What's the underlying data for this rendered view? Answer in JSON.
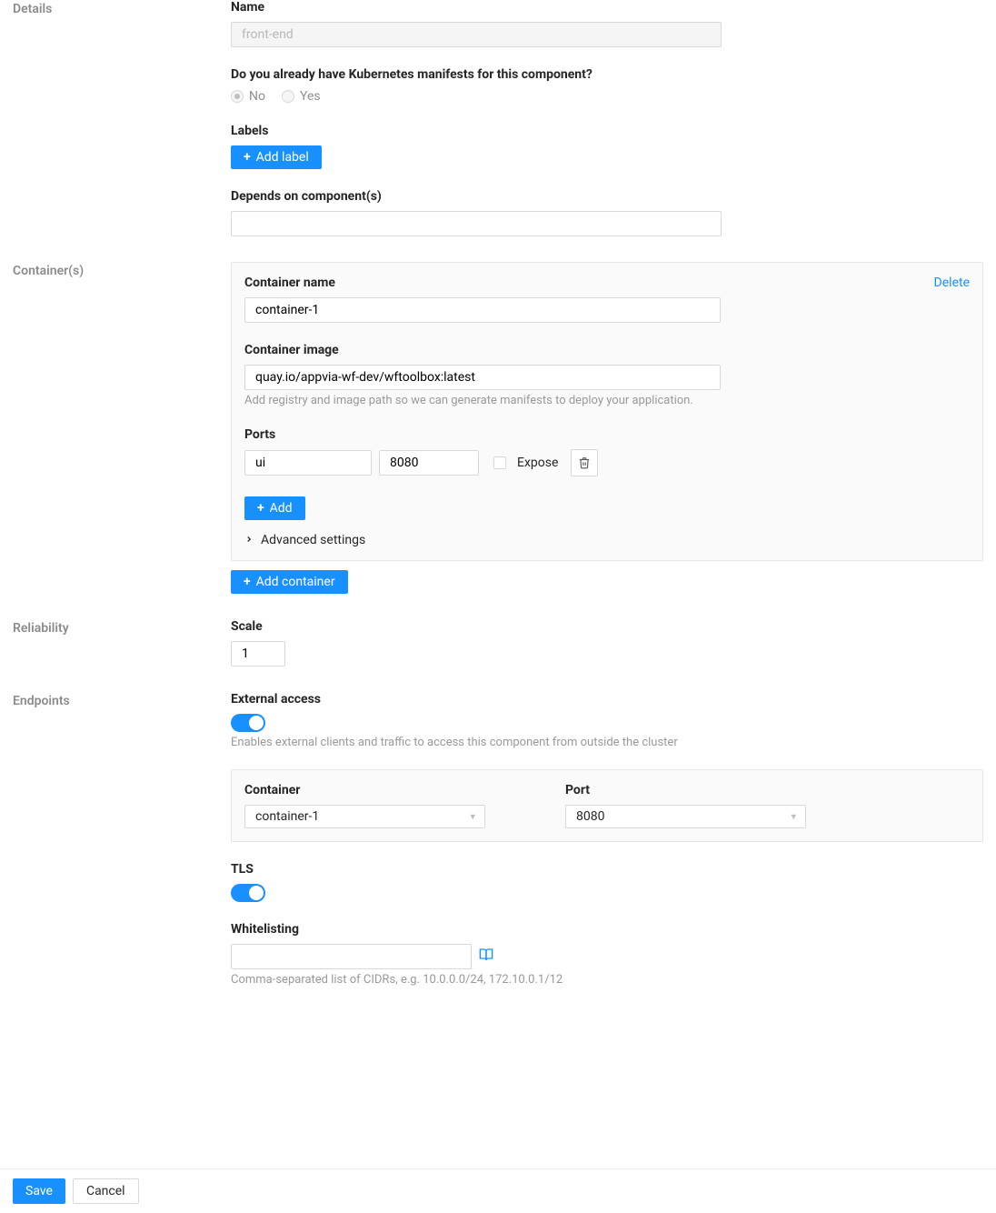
{
  "sections": {
    "details": "Details",
    "containers": "Container(s)",
    "reliability": "Reliability",
    "endpoints": "Endpoints"
  },
  "details": {
    "name_label": "Name",
    "name_value": "front-end",
    "manifests_question": "Do you already have Kubernetes manifests for this component?",
    "radio_no": "No",
    "radio_yes": "Yes",
    "labels_heading": "Labels",
    "add_label_btn": "Add label",
    "depends_label": "Depends on component(s)"
  },
  "container": {
    "delete": "Delete",
    "name_label": "Container name",
    "name_value": "container-1",
    "image_label": "Container image",
    "image_value": "quay.io/appvia-wf-dev/wftoolbox:latest",
    "image_hint": "Add registry and image path so we can generate manifests to deploy your application.",
    "ports_label": "Ports",
    "port_name": "ui",
    "port_number": "8080",
    "expose_label": "Expose",
    "add_btn": "Add",
    "advanced": "Advanced settings",
    "add_container_btn": "Add container"
  },
  "reliability": {
    "scale_label": "Scale",
    "scale_value": "1"
  },
  "endpoints": {
    "external_label": "External access",
    "external_hint": "Enables external clients and traffic to access this component from outside the cluster",
    "container_label": "Container",
    "container_value": "container-1",
    "port_label": "Port",
    "port_value": "8080",
    "tls_label": "TLS",
    "whitelist_label": "Whitelisting",
    "whitelist_hint": "Comma-separated list of CIDRs, e.g. 10.0.0.0/24, 172.10.0.1/12"
  },
  "footer": {
    "save": "Save",
    "cancel": "Cancel"
  }
}
